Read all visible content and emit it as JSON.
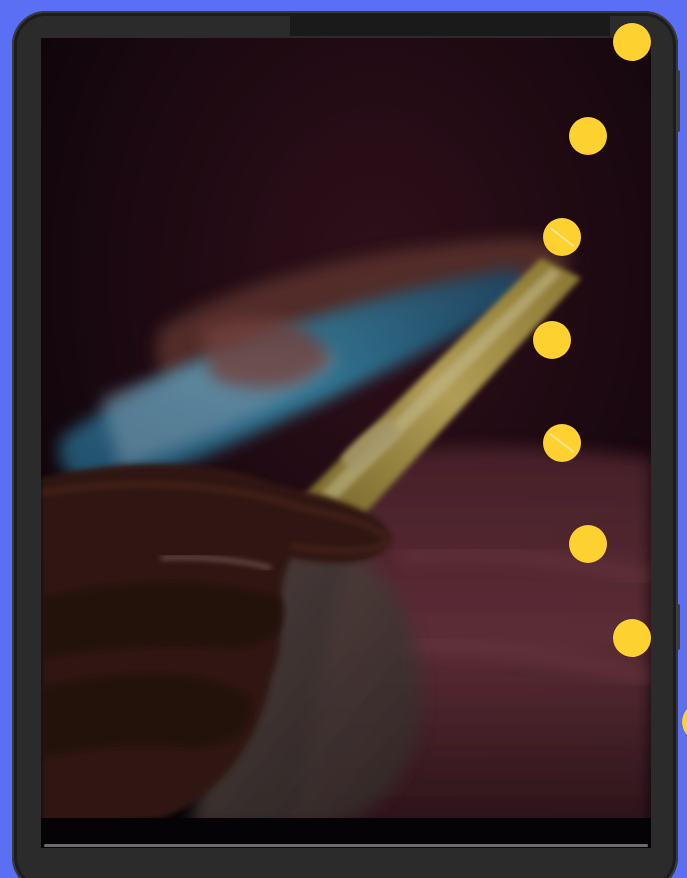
{
  "colors": {
    "background": "#5b6ff5",
    "dot": "#fdd230",
    "bezel": "#2b2b2b"
  },
  "image": {
    "subject": "hands-holding-phone-photo"
  },
  "dots_count": 8
}
